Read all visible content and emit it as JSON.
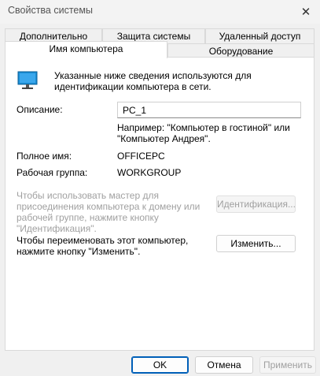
{
  "window": {
    "title": "Свойства системы"
  },
  "tabs": {
    "advanced": "Дополнительно",
    "protection": "Защита системы",
    "remote": "Удаленный доступ",
    "computer_name": "Имя компьютера",
    "hardware": "Оборудование"
  },
  "info": {
    "line1": "Указанные ниже сведения используются для",
    "line2": "идентификации компьютера в сети."
  },
  "description": {
    "label": "Описание:",
    "value": "PC_1",
    "example_line1": "Например: \"Компьютер в гостиной\" или",
    "example_line2": "\"Компьютер Андрея\"."
  },
  "full_name": {
    "label": "Полное имя:",
    "value": "OFFICEPC"
  },
  "workgroup": {
    "label": "Рабочая группа:",
    "value": "WORKGROUP"
  },
  "network_id": {
    "line1": "Чтобы использовать мастер для",
    "line2": "присоединения компьютера к домену или",
    "line3": "рабочей группе, нажмите кнопку",
    "line4": "\"Идентификация\".",
    "button": "Идентификация..."
  },
  "rename": {
    "line1": "Чтобы переименовать этот компьютер,",
    "line2": "нажмите кнопку \"Изменить\".",
    "button": "Изменить..."
  },
  "footer": {
    "ok": "OK",
    "cancel": "Отмена",
    "apply": "Применить"
  },
  "colors": {
    "accent": "#005fb8",
    "monitor": "#1b8fd6",
    "disabled": "#a0a0a0"
  }
}
